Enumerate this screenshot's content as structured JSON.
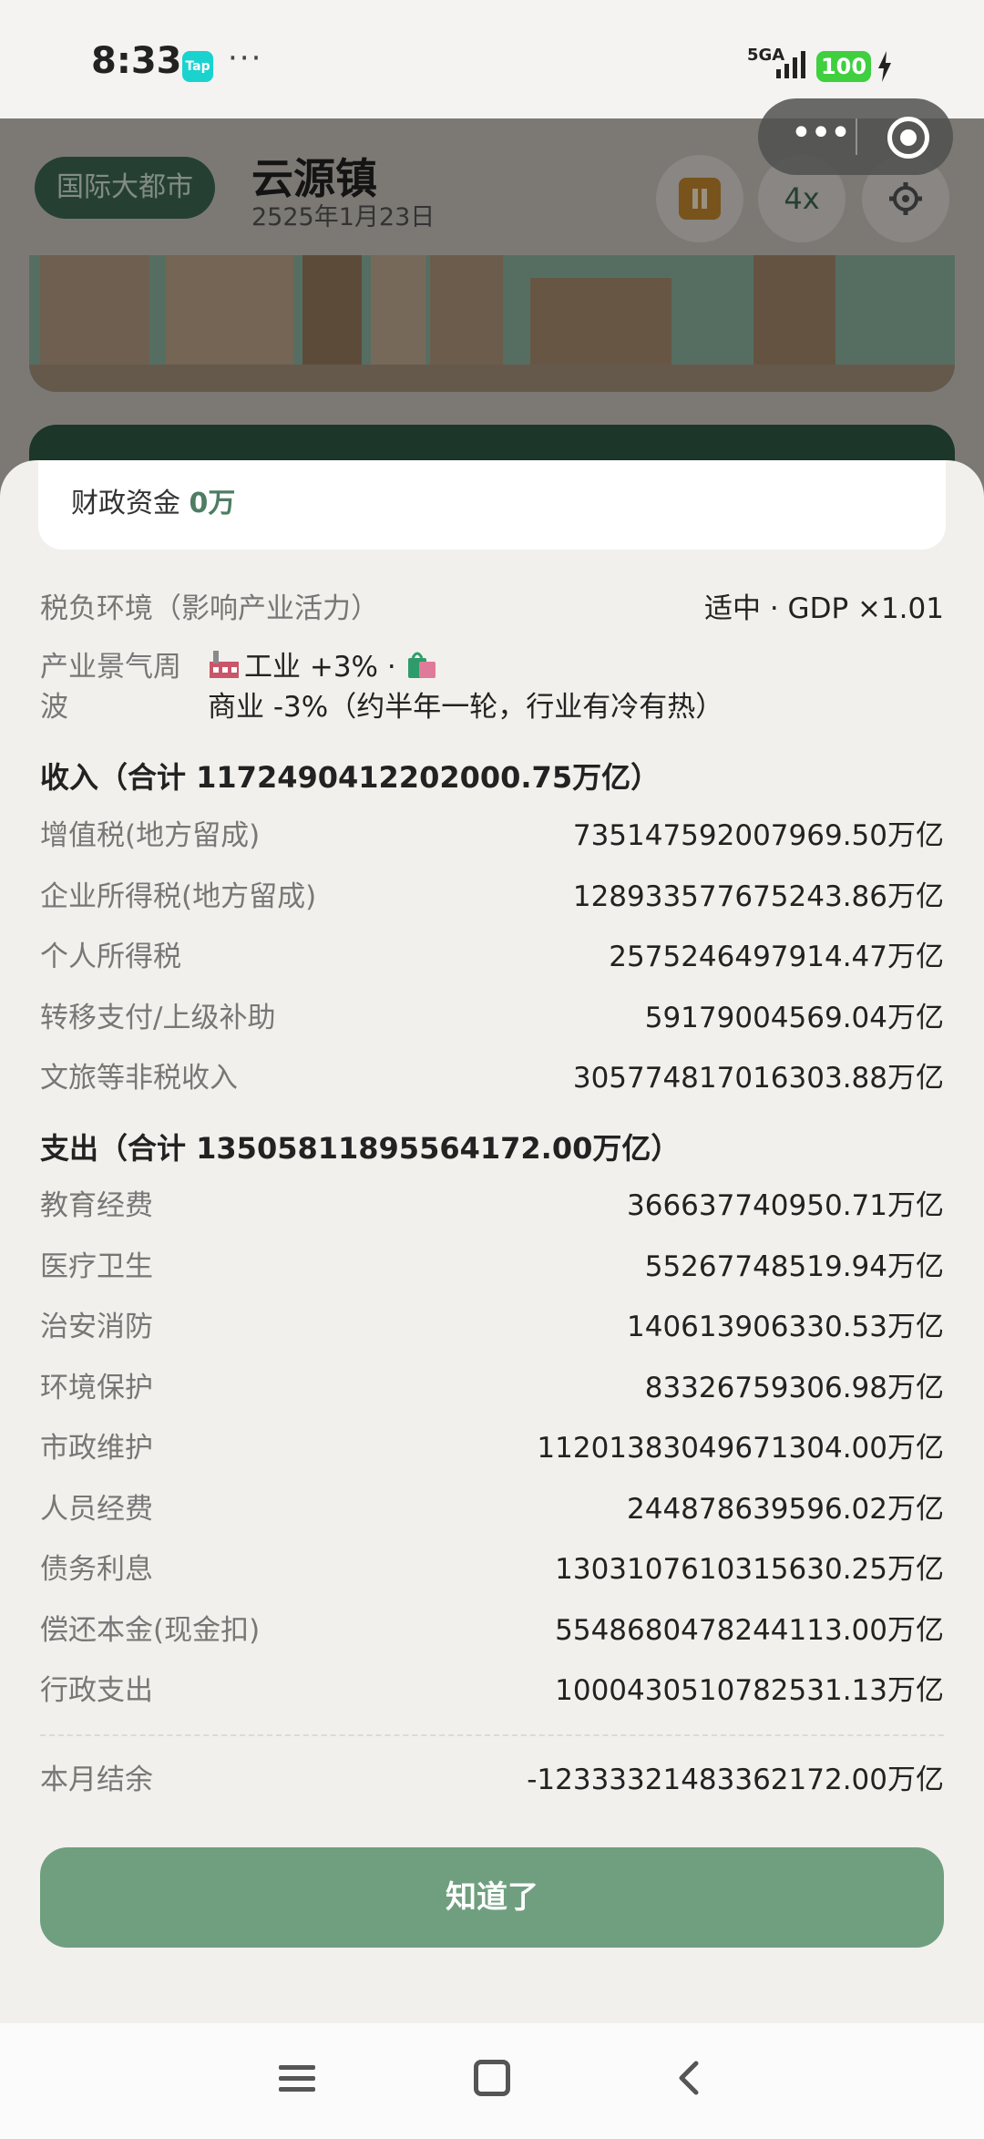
{
  "status_bar": {
    "time": "8:33",
    "tap_badge": "Tap",
    "dots": "···",
    "network": "5GA",
    "battery": "100"
  },
  "header": {
    "city_level": "国际大都市",
    "town_name": "云源镇",
    "date": "2525年1月23日",
    "speed": "4x"
  },
  "sheet": {
    "fund_label": "财政资金",
    "fund_value": "0万",
    "tax_env_label": "税负环境（影响产业活力）",
    "tax_env_value": "适中 · GDP ×1.01",
    "cycle_label": "产业景气周波",
    "cycle_industry": "工业 +3% · ",
    "cycle_commerce": "商业 -3%（约半年一轮，行业有冷有热）",
    "income_title": "收入（合计 1172490412202000.75万亿）",
    "income": [
      {
        "label": "增值税(地方留成)",
        "value": "735147592007969.50万亿"
      },
      {
        "label": "企业所得税(地方留成)",
        "value": "128933577675243.86万亿"
      },
      {
        "label": "个人所得税",
        "value": "2575246497914.47万亿"
      },
      {
        "label": "转移支付/上级补助",
        "value": "59179004569.04万亿"
      },
      {
        "label": "文旅等非税收入",
        "value": "305774817016303.88万亿"
      }
    ],
    "expense_title": "支出（合计 13505811895564172.00万亿）",
    "expenses": [
      {
        "label": "教育经费",
        "value": "366637740950.71万亿"
      },
      {
        "label": "医疗卫生",
        "value": "55267748519.94万亿"
      },
      {
        "label": "治安消防",
        "value": "140613906330.53万亿"
      },
      {
        "label": "环境保护",
        "value": "83326759306.98万亿"
      },
      {
        "label": "市政维护",
        "value": "11201383049671304.00万亿"
      },
      {
        "label": "人员经费",
        "value": "244878639596.02万亿"
      },
      {
        "label": "债务利息",
        "value": "1303107610315630.25万亿"
      },
      {
        "label": "偿还本金(现金扣)",
        "value": "554868047824411 3.00万亿"
      },
      {
        "label": "行政支出",
        "value": "1000430510782531.13万亿"
      }
    ],
    "balance_label": "本月结余",
    "balance_value": "-12333321483362172.00万亿",
    "ok_button": "知道了"
  },
  "colors": {
    "accent": "#6f9f7f",
    "fund_value": "#4e7d63",
    "battery": "#3fcf3f"
  }
}
